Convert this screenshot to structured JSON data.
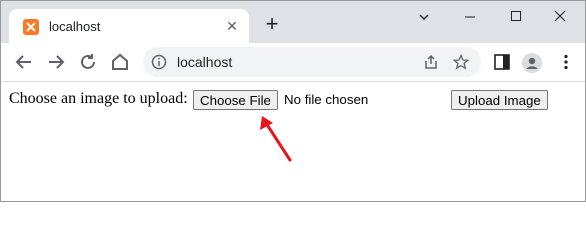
{
  "browser": {
    "tab_title": "localhost",
    "url": "localhost"
  },
  "page": {
    "prompt_label": "Choose an image to upload:",
    "file_button_label": "Choose File",
    "file_status": "No file chosen",
    "upload_button_label": "Upload Image"
  },
  "colors": {
    "annotation_arrow": "#e8141c",
    "favicon": "#fb7a24",
    "tabbar_bg": "#dee1e6"
  }
}
